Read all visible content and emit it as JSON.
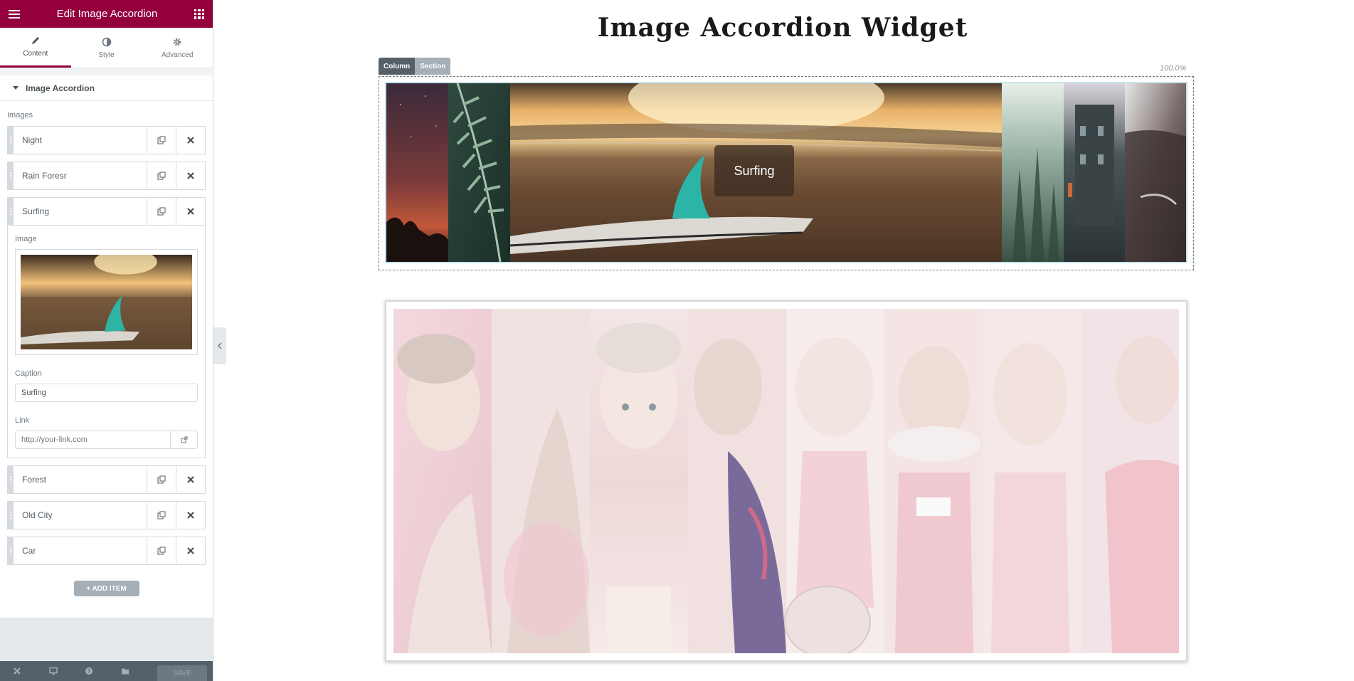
{
  "header": {
    "title": "Edit Image Accordion",
    "menu_icon": "hamburger-icon",
    "apps_icon": "grid-icon"
  },
  "tabs": [
    {
      "label": "Content",
      "icon": "pencil-icon",
      "active": true
    },
    {
      "label": "Style",
      "icon": "half-circle-icon",
      "active": false
    },
    {
      "label": "Advanced",
      "icon": "gear-icon",
      "active": false
    }
  ],
  "section": {
    "title": "Image Accordion"
  },
  "images_label": "Images",
  "items": [
    {
      "title": "Night"
    },
    {
      "title": "Rain Foresr"
    },
    {
      "title": "Surfing"
    },
    {
      "title": "Forest"
    },
    {
      "title": "Old City"
    },
    {
      "title": "Car"
    }
  ],
  "expanded": {
    "image_label": "Image",
    "caption_label": "Caption",
    "caption_value": "Surfing",
    "link_label": "Link",
    "link_placeholder": "http://your-link.com"
  },
  "add_item_label": "+ ADD ITEM",
  "footer": {
    "save_label": "SAVE",
    "icons": [
      "close-icon",
      "desktop-icon",
      "help-icon",
      "folder-icon"
    ]
  },
  "preview": {
    "page_title": "Image Accordion Widget",
    "handle_column": "Column",
    "handle_section": "Section",
    "width_percent": "100.0%",
    "active_caption": "Surfing"
  },
  "colors": {
    "brand": "#93003c",
    "panel_border": "#d5dadf",
    "footer": "#556068",
    "add_button": "#a4afb7"
  }
}
